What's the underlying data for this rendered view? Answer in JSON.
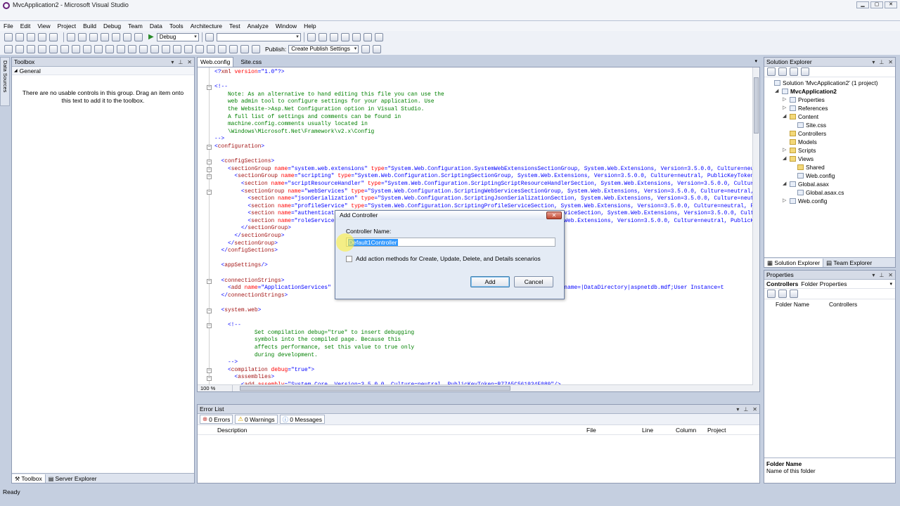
{
  "window": {
    "title": "MvcApplication2 - Microsoft Visual Studio"
  },
  "menu": [
    "File",
    "Edit",
    "View",
    "Project",
    "Build",
    "Debug",
    "Team",
    "Data",
    "Tools",
    "Architecture",
    "Test",
    "Analyze",
    "Window",
    "Help"
  ],
  "toolbar": {
    "config": "Debug",
    "platform": "",
    "publish_label": "Publish:",
    "publish_value": "Create Publish Settings"
  },
  "toolbox": {
    "title": "Toolbox",
    "group": "General",
    "empty_message": "There are no usable controls in this group. Drag an item onto this text to add it to the toolbox.",
    "bottom_tabs": [
      "Toolbox",
      "Server Explorer"
    ],
    "side_tab": "Data Sources"
  },
  "editor": {
    "tabs": [
      "Web.config",
      "Site.css"
    ],
    "zoom": "100 %",
    "lines": [
      [
        [
          "c-m",
          "<?"
        ],
        [
          "c-tag",
          "xml"
        ],
        [
          "c-att",
          " version"
        ],
        [
          "c-m",
          "=\""
        ],
        [
          "c-val",
          "1.0"
        ],
        [
          "c-m",
          "\"?>"
        ]
      ],
      [
        [
          "c-t",
          ""
        ]
      ],
      [
        [
          "c-m",
          "<!--"
        ]
      ],
      [
        [
          "c-cm",
          "    Note: As an alternative to hand editing this file you can use the"
        ]
      ],
      [
        [
          "c-cm",
          "    web admin tool to configure settings for your application. Use"
        ]
      ],
      [
        [
          "c-cm",
          "    the Website->Asp.Net Configuration option in Visual Studio."
        ]
      ],
      [
        [
          "c-cm",
          "    A full list of settings and comments can be found in"
        ]
      ],
      [
        [
          "c-cm",
          "    machine.config.comments usually located in"
        ]
      ],
      [
        [
          "c-cm",
          "    \\Windows\\Microsoft.Net\\Framework\\v2.x\\Config"
        ]
      ],
      [
        [
          "c-m",
          "-->"
        ]
      ],
      [
        [
          "c-m",
          "<"
        ],
        [
          "c-tag",
          "configuration"
        ],
        [
          "c-m",
          ">"
        ]
      ],
      [
        [
          "c-t",
          ""
        ]
      ],
      [
        [
          "c-m",
          "  <"
        ],
        [
          "c-tag",
          "configSections"
        ],
        [
          "c-m",
          ">"
        ]
      ],
      [
        [
          "c-m",
          "    <"
        ],
        [
          "c-tag",
          "sectionGroup"
        ],
        [
          "c-att",
          " name"
        ],
        [
          "c-m",
          "=\""
        ],
        [
          "c-val",
          "system.web.extensions"
        ],
        [
          "c-m",
          "\""
        ],
        [
          "c-att",
          " type"
        ],
        [
          "c-m",
          "=\""
        ],
        [
          "c-val",
          "System.Web.Configuration.SystemWebExtensionsSectionGroup, System.Web.Extensions, Version=3.5.0.0, Culture=neutr"
        ]
      ],
      [
        [
          "c-m",
          "      <"
        ],
        [
          "c-tag",
          "sectionGroup"
        ],
        [
          "c-att",
          " name"
        ],
        [
          "c-m",
          "=\""
        ],
        [
          "c-val",
          "scripting"
        ],
        [
          "c-m",
          "\""
        ],
        [
          "c-att",
          " type"
        ],
        [
          "c-m",
          "=\""
        ],
        [
          "c-val",
          "System.Web.Configuration.ScriptingSectionGroup, System.Web.Extensions, Version=3.5.0.0, Culture=neutral, PublicKeyToken=3"
        ]
      ],
      [
        [
          "c-m",
          "        <"
        ],
        [
          "c-tag",
          "section"
        ],
        [
          "c-att",
          " name"
        ],
        [
          "c-m",
          "=\""
        ],
        [
          "c-val",
          "scriptResourceHandler"
        ],
        [
          "c-m",
          "\""
        ],
        [
          "c-att",
          " type"
        ],
        [
          "c-m",
          "=\""
        ],
        [
          "c-val",
          "System.Web.Configuration.ScriptingScriptResourceHandlerSection, System.Web.Extensions, Version=3.5.0.0, Culture="
        ]
      ],
      [
        [
          "c-m",
          "        <"
        ],
        [
          "c-tag",
          "sectionGroup"
        ],
        [
          "c-att",
          " name"
        ],
        [
          "c-m",
          "=\""
        ],
        [
          "c-val",
          "webServices"
        ],
        [
          "c-m",
          "\""
        ],
        [
          "c-att",
          " type"
        ],
        [
          "c-m",
          "=\""
        ],
        [
          "c-val",
          "System.Web.Configuration.ScriptingWebServicesSectionGroup, System.Web.Extensions, Version=3.5.0.0, Culture=neutral, P"
        ]
      ],
      [
        [
          "c-m",
          "          <"
        ],
        [
          "c-tag",
          "section"
        ],
        [
          "c-att",
          " name"
        ],
        [
          "c-m",
          "=\""
        ],
        [
          "c-val",
          "jsonSerialization"
        ],
        [
          "c-m",
          "\""
        ],
        [
          "c-att",
          " type"
        ],
        [
          "c-m",
          "=\""
        ],
        [
          "c-val",
          "System.Web.Configuration.ScriptingJsonSerializationSection, System.Web.Extensions, Version=3.5.0.0, Culture=neutra"
        ]
      ],
      [
        [
          "c-m",
          "          <"
        ],
        [
          "c-tag",
          "section"
        ],
        [
          "c-att",
          " name"
        ],
        [
          "c-m",
          "=\""
        ],
        [
          "c-val",
          "profileService"
        ],
        [
          "c-m",
          "\""
        ],
        [
          "c-att",
          " type"
        ],
        [
          "c-m",
          "=\""
        ],
        [
          "c-val",
          "System.Web.Configuration.ScriptingProfileServiceSection, System.Web.Extensions, Version=3.5.0.0, Culture=neutral, Pub"
        ]
      ],
      [
        [
          "c-m",
          "          <"
        ],
        [
          "c-tag",
          "section"
        ],
        [
          "c-att",
          " name"
        ],
        [
          "c-m",
          "=\""
        ],
        [
          "c-val",
          "authenticationService"
        ],
        [
          "c-m",
          "\""
        ],
        [
          "c-att",
          " type"
        ],
        [
          "c-m",
          "=\""
        ],
        [
          "c-val",
          "System.Web.Configuration.ScriptingAuthenticationServiceSection, System.Web.Extensions, Version=3.5.0.0, Cultur"
        ]
      ],
      [
        [
          "c-m",
          "          <"
        ],
        [
          "c-tag",
          "section"
        ],
        [
          "c-att",
          " name"
        ],
        [
          "c-m",
          "=\""
        ],
        [
          "c-val",
          "roleService"
        ],
        [
          "c-m",
          "\""
        ],
        [
          "c-att",
          " type"
        ],
        [
          "c-m",
          "=\""
        ],
        [
          "c-val",
          "System.Web.Configuration.ScriptingRoleServiceSection, System.Web.Extensions, Version=3.5.0.0, Culture=neutral, PublicKey"
        ]
      ],
      [
        [
          "c-m",
          "        </"
        ],
        [
          "c-tag",
          "sectionGroup"
        ],
        [
          "c-m",
          ">"
        ]
      ],
      [
        [
          "c-m",
          "      </"
        ],
        [
          "c-tag",
          "sectionGroup"
        ],
        [
          "c-m",
          ">"
        ]
      ],
      [
        [
          "c-m",
          "    </"
        ],
        [
          "c-tag",
          "sectionGroup"
        ],
        [
          "c-m",
          ">"
        ]
      ],
      [
        [
          "c-m",
          "  </"
        ],
        [
          "c-tag",
          "configSections"
        ],
        [
          "c-m",
          ">"
        ]
      ],
      [
        [
          "c-t",
          ""
        ]
      ],
      [
        [
          "c-m",
          "  <"
        ],
        [
          "c-tag",
          "appSettings"
        ],
        [
          "c-m",
          "/>"
        ]
      ],
      [
        [
          "c-t",
          ""
        ]
      ],
      [
        [
          "c-m",
          "  <"
        ],
        [
          "c-tag",
          "connectionStrings"
        ],
        [
          "c-m",
          ">"
        ]
      ],
      [
        [
          "c-m",
          "    <"
        ],
        [
          "c-tag",
          "add"
        ],
        [
          "c-att",
          " name"
        ],
        [
          "c-m",
          "=\""
        ],
        [
          "c-val",
          "ApplicationServices"
        ],
        [
          "c-m",
          "\""
        ],
        [
          "c-val",
          "                                                             achDBFilename=|DataDirectory|aspnetdb.mdf;User Instance=t"
        ]
      ],
      [
        [
          "c-m",
          "  </"
        ],
        [
          "c-tag",
          "connectionStrings"
        ],
        [
          "c-m",
          ">"
        ]
      ],
      [
        [
          "c-t",
          ""
        ]
      ],
      [
        [
          "c-m",
          "  <"
        ],
        [
          "c-tag",
          "system.web"
        ],
        [
          "c-m",
          ">"
        ]
      ],
      [
        [
          "c-t",
          ""
        ]
      ],
      [
        [
          "c-m",
          "    <!--"
        ]
      ],
      [
        [
          "c-cm",
          "            Set compilation debug=\"true\" to insert debugging"
        ]
      ],
      [
        [
          "c-cm",
          "            symbols into the compiled page. Because this"
        ]
      ],
      [
        [
          "c-cm",
          "            affects performance, set this value to true only"
        ]
      ],
      [
        [
          "c-cm",
          "            during development."
        ]
      ],
      [
        [
          "c-m",
          "    -->"
        ]
      ],
      [
        [
          "c-m",
          "    <"
        ],
        [
          "c-tag",
          "compilation"
        ],
        [
          "c-att",
          " debug"
        ],
        [
          "c-m",
          "=\""
        ],
        [
          "c-val",
          "true"
        ],
        [
          "c-m",
          "\">"
        ]
      ],
      [
        [
          "c-m",
          "      <"
        ],
        [
          "c-tag",
          "assemblies"
        ],
        [
          "c-m",
          ">"
        ]
      ],
      [
        [
          "c-m",
          "        <"
        ],
        [
          "c-tag",
          "add"
        ],
        [
          "c-att",
          " assembly"
        ],
        [
          "c-m",
          "=\""
        ],
        [
          "c-val",
          "System.Core, Version=3.5.0.0, Culture=neutral, PublicKeyToken=B77A5C561934E089"
        ],
        [
          "c-m",
          "\"/>"
        ]
      ]
    ]
  },
  "dialog": {
    "title": "Add Controller",
    "name_label": "Controller Name:",
    "name_value": "Default1Controller",
    "checkbox_label": "Add action methods for Create, Update, Delete, and Details scenarios",
    "add": "Add",
    "cancel": "Cancel"
  },
  "error_list": {
    "title": "Error List",
    "errors": "0 Errors",
    "warnings": "0 Warnings",
    "messages": "0 Messages",
    "columns": [
      "Description",
      "File",
      "Line",
      "Column",
      "Project"
    ]
  },
  "solution_explorer": {
    "title": "Solution Explorer",
    "items": [
      {
        "label": "Solution 'MvcApplication2' (1 project)",
        "indent": 0,
        "exp": "",
        "icon": "sol"
      },
      {
        "label": "MvcApplication2",
        "indent": 1,
        "exp": "◢",
        "icon": "proj",
        "bold": true
      },
      {
        "label": "Properties",
        "indent": 2,
        "exp": "▷",
        "icon": "file"
      },
      {
        "label": "References",
        "indent": 2,
        "exp": "▷",
        "icon": "file"
      },
      {
        "label": "Content",
        "indent": 2,
        "exp": "◢",
        "icon": "folder"
      },
      {
        "label": "Site.css",
        "indent": 3,
        "exp": "",
        "icon": "file"
      },
      {
        "label": "Controllers",
        "indent": 2,
        "exp": "",
        "icon": "folder"
      },
      {
        "label": "Models",
        "indent": 2,
        "exp": "",
        "icon": "folder"
      },
      {
        "label": "Scripts",
        "indent": 2,
        "exp": "▷",
        "icon": "folder"
      },
      {
        "label": "Views",
        "indent": 2,
        "exp": "◢",
        "icon": "folder"
      },
      {
        "label": "Shared",
        "indent": 3,
        "exp": "",
        "icon": "folder"
      },
      {
        "label": "Web.config",
        "indent": 3,
        "exp": "",
        "icon": "file"
      },
      {
        "label": "Global.asax",
        "indent": 2,
        "exp": "◢",
        "icon": "file"
      },
      {
        "label": "Global.asax.cs",
        "indent": 3,
        "exp": "",
        "icon": "file"
      },
      {
        "label": "Web.config",
        "indent": 2,
        "exp": "▷",
        "icon": "file"
      }
    ],
    "tabs": [
      "Solution Explorer",
      "Team Explorer"
    ]
  },
  "properties": {
    "title": "Properties",
    "object_name": "Controllers",
    "object_type": "Folder Properties",
    "row_name": "Folder Name",
    "row_value": "Controllers",
    "desc_title": "Folder Name",
    "desc_text": "Name of this folder"
  },
  "status": {
    "text": "Ready"
  }
}
